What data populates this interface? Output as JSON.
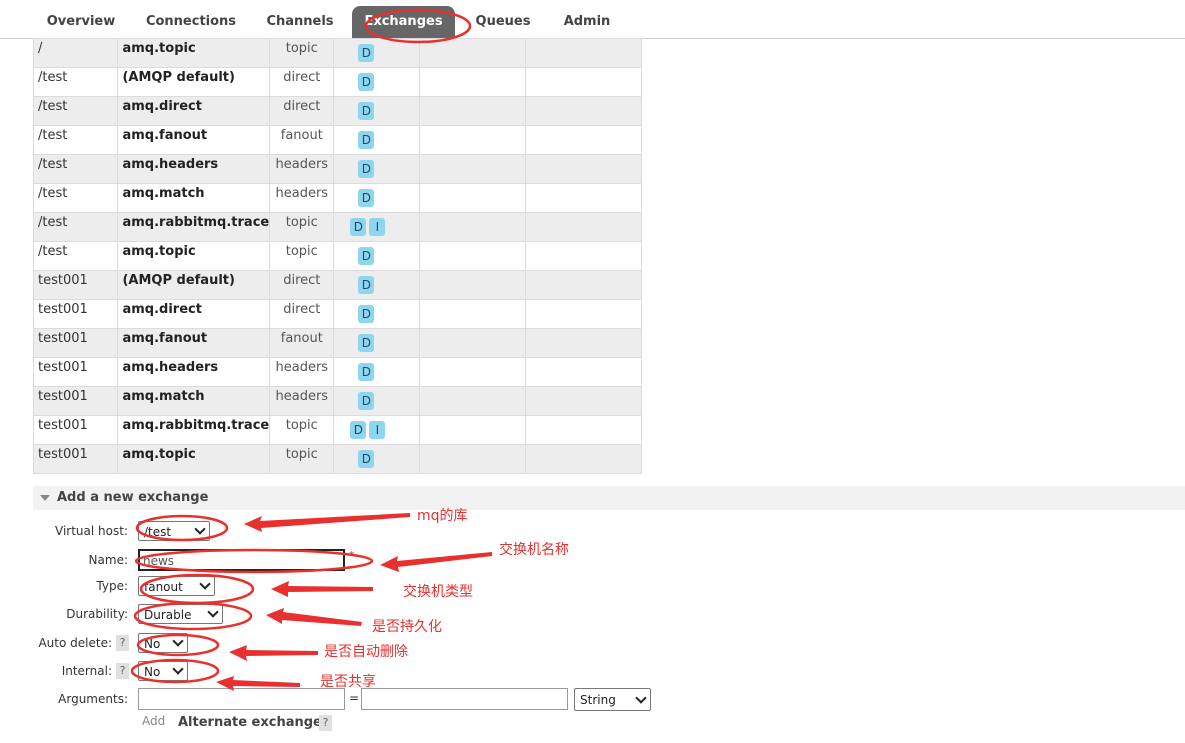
{
  "nav": {
    "tabs": [
      {
        "label": "Overview"
      },
      {
        "label": "Connections"
      },
      {
        "label": "Channels"
      },
      {
        "label": "Exchanges"
      },
      {
        "label": "Queues"
      },
      {
        "label": "Admin"
      }
    ],
    "active_index": 3
  },
  "exchanges": {
    "rows": [
      {
        "vhost": "/",
        "name": "amq.topic",
        "type": "topic",
        "features": [
          "D"
        ]
      },
      {
        "vhost": "/test",
        "name": "(AMQP default)",
        "type": "direct",
        "features": [
          "D"
        ]
      },
      {
        "vhost": "/test",
        "name": "amq.direct",
        "type": "direct",
        "features": [
          "D"
        ]
      },
      {
        "vhost": "/test",
        "name": "amq.fanout",
        "type": "fanout",
        "features": [
          "D"
        ]
      },
      {
        "vhost": "/test",
        "name": "amq.headers",
        "type": "headers",
        "features": [
          "D"
        ]
      },
      {
        "vhost": "/test",
        "name": "amq.match",
        "type": "headers",
        "features": [
          "D"
        ]
      },
      {
        "vhost": "/test",
        "name": "amq.rabbitmq.trace",
        "type": "topic",
        "features": [
          "D",
          "I"
        ]
      },
      {
        "vhost": "/test",
        "name": "amq.topic",
        "type": "topic",
        "features": [
          "D"
        ]
      },
      {
        "vhost": "test001",
        "name": "(AMQP default)",
        "type": "direct",
        "features": [
          "D"
        ]
      },
      {
        "vhost": "test001",
        "name": "amq.direct",
        "type": "direct",
        "features": [
          "D"
        ]
      },
      {
        "vhost": "test001",
        "name": "amq.fanout",
        "type": "fanout",
        "features": [
          "D"
        ]
      },
      {
        "vhost": "test001",
        "name": "amq.headers",
        "type": "headers",
        "features": [
          "D"
        ]
      },
      {
        "vhost": "test001",
        "name": "amq.match",
        "type": "headers",
        "features": [
          "D"
        ]
      },
      {
        "vhost": "test001",
        "name": "amq.rabbitmq.trace",
        "type": "topic",
        "features": [
          "D",
          "I"
        ]
      },
      {
        "vhost": "test001",
        "name": "amq.topic",
        "type": "topic",
        "features": [
          "D"
        ]
      }
    ]
  },
  "form": {
    "section_title": "Add a new exchange",
    "virtual_host_label": "Virtual host:",
    "virtual_host_value": "/test",
    "name_label": "Name:",
    "name_value": "news",
    "required_mark": "*",
    "type_label": "Type:",
    "type_value": "fanout",
    "durability_label": "Durability:",
    "durability_value": "Durable",
    "auto_delete_label": "Auto delete:",
    "auto_delete_value": "No",
    "internal_label": "Internal:",
    "internal_value": "No",
    "help_mark": "?",
    "arguments_label": "Arguments:",
    "arguments_equals": "=",
    "arguments_type": "String",
    "add_label": "Add",
    "alternate_exchange_label": "Alternate exchange",
    "alternate_help": "?"
  },
  "annotations": {
    "vhost": "mq的库",
    "name": "交换机名称",
    "type": "交换机类型",
    "durability": "是否持久化",
    "auto_delete": "是否自动删除",
    "internal": "是否共享"
  },
  "colors": {
    "annotation_red": "#e8302e",
    "active_tab_bg": "#666666",
    "badge_bg": "#8ed6f0"
  }
}
